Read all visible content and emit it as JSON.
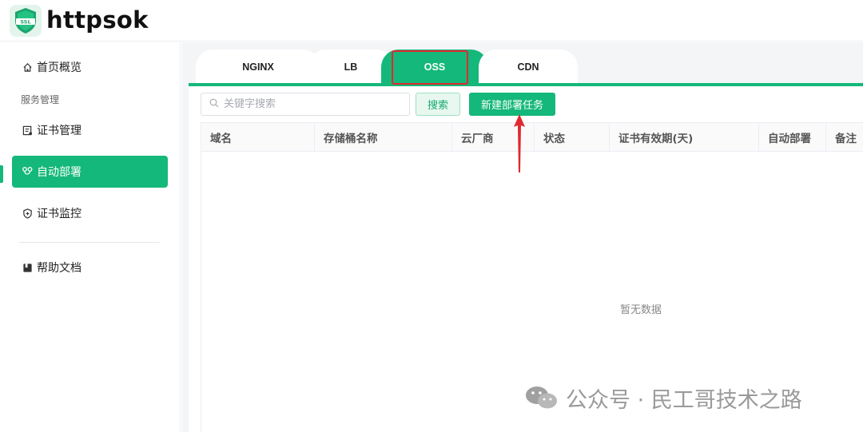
{
  "app": {
    "logo_badge_text": "SSL",
    "name": "httpsok"
  },
  "sidebar": {
    "items": [
      {
        "label": "首页概览",
        "icon": "home-icon"
      },
      {
        "label": "证书管理",
        "icon": "certificate-icon"
      },
      {
        "label": "自动部署",
        "icon": "deploy-icon",
        "active": true
      },
      {
        "label": "证书监控",
        "icon": "shield-icon"
      },
      {
        "label": "帮助文档",
        "icon": "book-icon"
      }
    ],
    "group_label": "服务管理"
  },
  "tabs": [
    {
      "label": "NGINX"
    },
    {
      "label": "LB"
    },
    {
      "label": "OSS",
      "active": true
    },
    {
      "label": "CDN"
    }
  ],
  "toolbar": {
    "search_placeholder": "关键字搜索",
    "search_button": "搜索",
    "new_task_button": "新建部署任务"
  },
  "table": {
    "columns": [
      "域名",
      "存储桶名称",
      "云厂商",
      "状态",
      "证书有效期(天)",
      "自动部署",
      "备注"
    ],
    "rows": [],
    "empty_text": "暂无数据"
  },
  "watermark": {
    "text": "公众号 · 民工哥技术之路"
  },
  "colors": {
    "brand": "#14b87a",
    "annotation": "#e0282e"
  }
}
